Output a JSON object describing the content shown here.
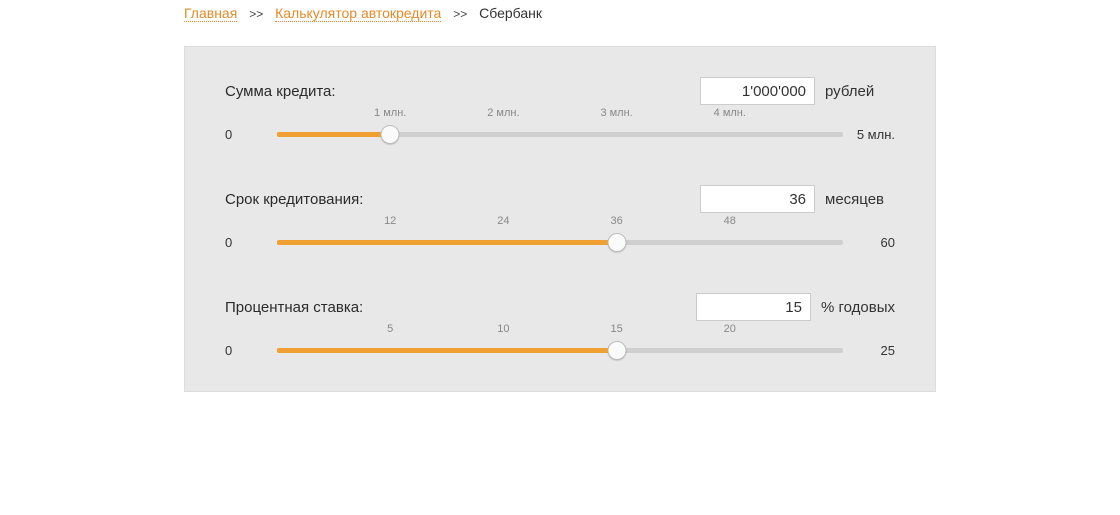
{
  "breadcrumb": {
    "home": "Главная",
    "calculator": "Калькулятор автокредита",
    "current": "Сбербанк",
    "sep": ">>"
  },
  "sliders": {
    "amount": {
      "label": "Сумма кредита:",
      "value": "1'000'000",
      "unit": "рублей",
      "min": "0",
      "max": "5 млн.",
      "percent": 20,
      "ticks": [
        {
          "pos": 20,
          "label": "1 млн."
        },
        {
          "pos": 40,
          "label": "2 млн."
        },
        {
          "pos": 60,
          "label": "3 млн."
        },
        {
          "pos": 80,
          "label": "4 млн."
        }
      ]
    },
    "term": {
      "label": "Срок кредитования:",
      "value": "36",
      "unit": "месяцев",
      "min": "0",
      "max": "60",
      "percent": 60,
      "ticks": [
        {
          "pos": 20,
          "label": "12"
        },
        {
          "pos": 40,
          "label": "24"
        },
        {
          "pos": 60,
          "label": "36"
        },
        {
          "pos": 80,
          "label": "48"
        }
      ]
    },
    "rate": {
      "label": "Процентная ставка:",
      "value": "15",
      "unit": "% годовых",
      "min": "0",
      "max": "25",
      "percent": 60,
      "ticks": [
        {
          "pos": 20,
          "label": "5"
        },
        {
          "pos": 40,
          "label": "10"
        },
        {
          "pos": 60,
          "label": "15"
        },
        {
          "pos": 80,
          "label": "20"
        }
      ]
    }
  }
}
